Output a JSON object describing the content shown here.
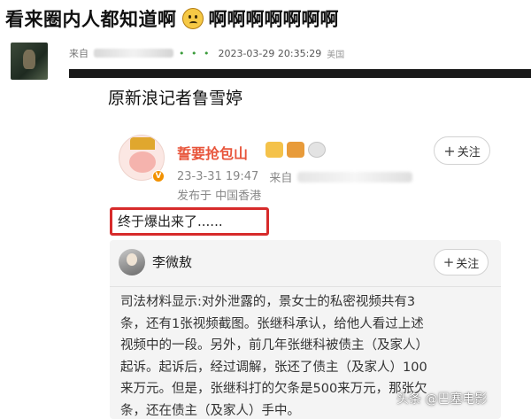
{
  "header": {
    "title": "看来圈内人都知道啊",
    "emoji": "confused-face-icon",
    "suffix": "啊啊啊啊啊啊啊"
  },
  "post": {
    "prefix": "来自",
    "dots": "• • •",
    "time": "2023-03-29 20:35:29",
    "location": "美国"
  },
  "screenshot": {
    "reporter_line": "原新浪记者鲁雪婷",
    "weibo": {
      "name": "誓要抢包山",
      "badge": "V",
      "time": "23-3-31 19:47",
      "source_prefix": "来自",
      "published_from": "发布于 中国香港",
      "follow_plus": "+",
      "follow_label": "关注",
      "highlight_text": "终于爆出来了......"
    },
    "quote": {
      "name": "李微敖",
      "follow_plus": "+",
      "follow_label": "关注",
      "lines": [
        "司法材料显示:对外泄露的，景女士的私密视频共有3",
        "条，还有1张视频截图。张继科承认，给他人看过上述",
        "视频中的一段。另外，前几年张继科被债主（及家人）",
        "起诉。起诉后，经过调解，张还了债主（及家人）100",
        "来万元。但是，张继科打的欠条是500来万元，那张欠",
        "条，还在债主（及家人）手中。"
      ]
    }
  },
  "watermark": "头条 @巴塞电影"
}
